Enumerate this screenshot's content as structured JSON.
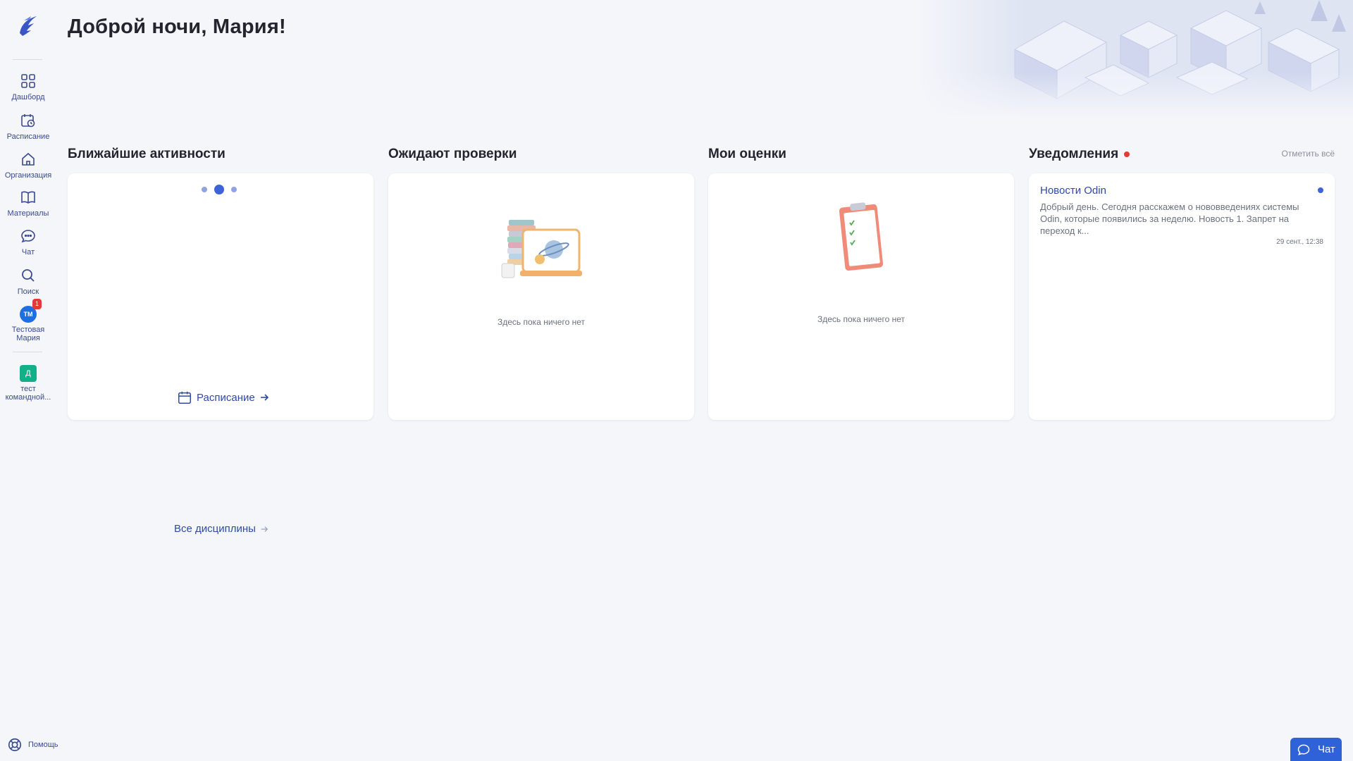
{
  "sidebar": {
    "items": [
      {
        "label": "Дашборд",
        "icon": "dashboard-grid-icon"
      },
      {
        "label": "Расписание",
        "icon": "calendar-clock-icon"
      },
      {
        "label": "Организация",
        "icon": "home-icon"
      },
      {
        "label": "Материалы",
        "icon": "book-icon"
      },
      {
        "label": "Чат",
        "icon": "chat-bubble-icon"
      },
      {
        "label": "Поиск",
        "icon": "search-icon"
      }
    ],
    "profile": {
      "initials": "ТМ",
      "badge": "1",
      "name": "Тестовая Мария"
    },
    "team": {
      "initial": "Д",
      "name": "тест командной..."
    },
    "help_label": "Помощь"
  },
  "header": {
    "greeting": "Доброй ночи, Мария!"
  },
  "sections": {
    "upcoming": {
      "title": "Ближайшие активности",
      "schedule_link": "Расписание"
    },
    "review": {
      "title": "Ожидают проверки",
      "empty_text": "Здесь пока ничего нет"
    },
    "grades": {
      "title": "Мои оценки",
      "empty_text": "Здесь пока ничего нет"
    },
    "notifications": {
      "title": "Уведомления",
      "mark_all": "Отметить всё",
      "items": [
        {
          "title": "Новости Odin",
          "body": "Добрый день. Сегодня расскажем о нововведениях системы Odin, которые появились за неделю. Новость 1. Запрет на переход к...",
          "time": "29 сент., 12:38"
        }
      ]
    }
  },
  "all_disciplines": "Все дисциплины",
  "chat_button": "Чат",
  "colors": {
    "accent": "#2f62d9",
    "link": "#2f4aa5",
    "alert": "#e53935",
    "background": "#f4f6fa"
  }
}
